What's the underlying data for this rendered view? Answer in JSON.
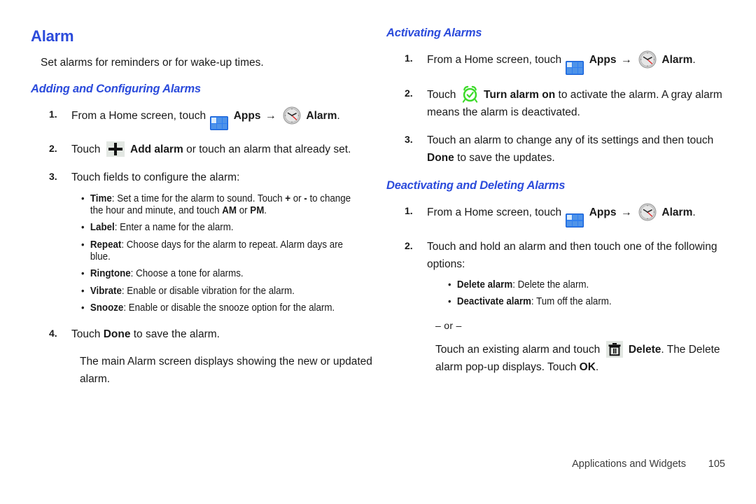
{
  "page": {
    "title": "Alarm",
    "lead": "Set alarms for reminders or for wake-up times.",
    "footer_section": "Applications and Widgets",
    "footer_page": "105"
  },
  "colors": {
    "heading_blue": "#2b4bdb",
    "apps_icon_blue": "#2f7ff0",
    "alarm_on_green": "#3ddb2a",
    "body_text": "#1a1a1a"
  },
  "left_column": {
    "section_heading": "Adding and Configuring Alarms",
    "step1": {
      "num": "1.",
      "text_before": "From a Home screen, touch",
      "apps_label": "Apps",
      "arrow": "→",
      "alarm_label": "Alarm",
      "period": "."
    },
    "step2": {
      "num": "2.",
      "text_before": "Touch",
      "bold_label": "Add alarm",
      "text_after": "or touch an alarm that already set."
    },
    "step3": {
      "num": "3.",
      "text": "Touch fields to configure the alarm:",
      "bullets": [
        {
          "label": "Time",
          "text": ": Set a time for the alarm to sound. Touch ",
          "bold_plus": "+",
          "mid": " or ",
          "bold_minus": "-",
          "text2": " to change the hour and minute, and touch ",
          "bold_am": "AM",
          "mid2": " or ",
          "bold_pm": "PM",
          "end": "."
        },
        {
          "label": "Label",
          "text": ": Enter a name for the alarm."
        },
        {
          "label": "Repeat",
          "text": ": Choose days for the alarm to repeat. Alarm days are blue."
        },
        {
          "label": "Ringtone",
          "text": ": Choose a tone for alarms."
        },
        {
          "label": "Vibrate",
          "text": ": Enable or disable vibration for the alarm."
        },
        {
          "label": "Snooze",
          "text": ": Enable or disable the snooze option for the alarm."
        }
      ]
    },
    "step4": {
      "num": "4.",
      "text_before": "Touch",
      "bold_label": "Done",
      "text_after": "to save the alarm."
    },
    "step4_note": "The main Alarm screen displays showing the new or updated alarm."
  },
  "right_column": {
    "activating_heading": "Activating Alarms",
    "act_step1": {
      "num": "1.",
      "text_before": "From a Home screen, touch",
      "apps_label": "Apps",
      "arrow": "→",
      "alarm_label": "Alarm",
      "period": "."
    },
    "act_step2": {
      "num": "2.",
      "text_before": "Touch",
      "bold_label": "Turn alarm on",
      "text_after": "to activate the alarm. A gray alarm means the alarm is deactivated."
    },
    "act_step3": {
      "num": "3.",
      "text_before": "Touch an alarm to change any of its settings and then touch",
      "bold_label": "Done",
      "text_after": "to save the updates."
    },
    "deactivating_heading": "Deactivating and Deleting Alarms",
    "deact_step1": {
      "num": "1.",
      "text_before": "From a Home screen, touch",
      "apps_label": "Apps",
      "arrow": "→",
      "alarm_label": "Alarm",
      "period": "."
    },
    "deact_step2": {
      "num": "2.",
      "text": "Touch and hold an alarm and then touch one of the following options:",
      "bullets": [
        {
          "label": "Delete alarm",
          "text": ": Delete the alarm."
        },
        {
          "label": "Deactivate alarm",
          "text": ": Tum off the alarm."
        }
      ]
    },
    "or_separator": "– or –",
    "delete_note": {
      "text_before": "Touch an existing alarm and touch",
      "bold_label": "Delete",
      "text_mid": ". The Delete alarm pop-up displays. Touch",
      "bold_ok": "OK",
      "text_end": "."
    }
  },
  "icons": {
    "apps": "apps-grid-icon",
    "clock": "analog-clock-icon",
    "alarm_on": "alarm-on-green-icon",
    "plus": "add-plus-icon",
    "trash": "delete-trash-icon"
  }
}
